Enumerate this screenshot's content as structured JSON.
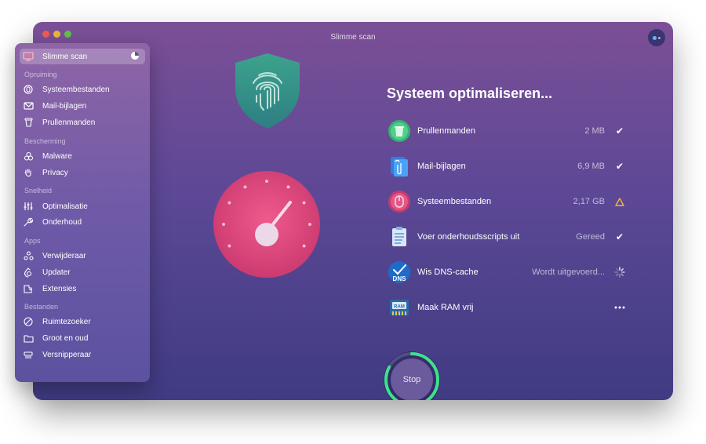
{
  "window": {
    "title": "Slimme scan"
  },
  "sidebar": {
    "top_item": {
      "label": "Slimme scan"
    },
    "sections": [
      {
        "heading": "Opruiming",
        "items": [
          "Systeembestanden",
          "Mail-bijlagen",
          "Prullenmanden"
        ]
      },
      {
        "heading": "Bescherming",
        "items": [
          "Malware",
          "Privacy"
        ]
      },
      {
        "heading": "Snelheid",
        "items": [
          "Optimalisatie",
          "Onderhoud"
        ]
      },
      {
        "heading": "Apps",
        "items": [
          "Verwijderaar",
          "Updater",
          "Extensies"
        ]
      },
      {
        "heading": "Bestanden",
        "items": [
          "Ruimtezoeker",
          "Groot en oud",
          "Versnipperaar"
        ]
      }
    ]
  },
  "main": {
    "title": "Systeem optimaliseren...",
    "tasks": [
      {
        "name": "Prullenmanden",
        "value": "2 MB",
        "status": "done",
        "icon": "trash-icon"
      },
      {
        "name": "Mail-bijlagen",
        "value": "6,9 MB",
        "status": "done",
        "icon": "mail-attachments-icon"
      },
      {
        "name": "Systeembestanden",
        "value": "2,17 GB",
        "status": "warning",
        "icon": "system-files-icon"
      },
      {
        "name": "Voer onderhoudsscripts uit",
        "value": "Gereed",
        "status": "done",
        "icon": "maintenance-scripts-icon"
      },
      {
        "name": "Wis DNS-cache",
        "value": "Wordt uitgevoerd...",
        "status": "running",
        "icon": "dns-icon"
      },
      {
        "name": "Maak RAM vrij",
        "value": "",
        "status": "pending",
        "icon": "ram-icon"
      }
    ],
    "dns_icon_text": "DNS",
    "ram_icon_text": "RAM",
    "stop_label": "Stop",
    "stop_progress": 0.83
  },
  "colors": {
    "accent_green": "#3fe08a",
    "warning": "#f5b93a",
    "gauge_pink": "#e2457c",
    "shield_teal": "#3aa38a"
  }
}
